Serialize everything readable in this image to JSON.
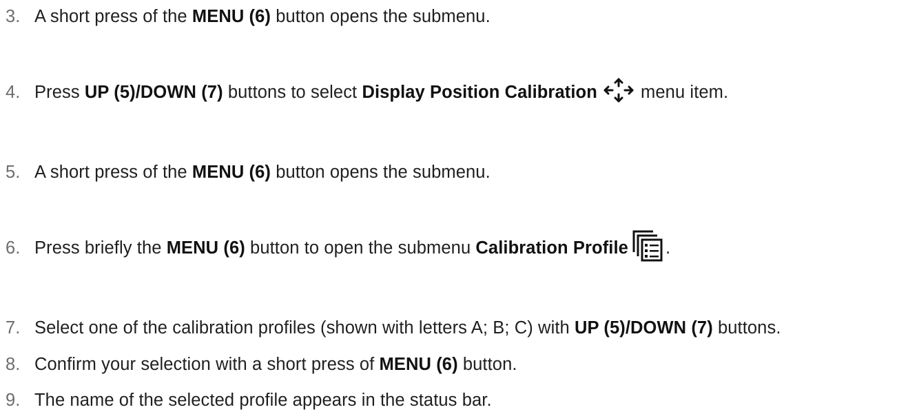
{
  "steps": [
    {
      "number": "3.",
      "parts": [
        "A short press of the ",
        "MENU (6)",
        " button opens the submenu."
      ]
    },
    {
      "number": "4.",
      "parts": [
        "Press ",
        "UP (5)/DOWN (7)",
        " buttons to select ",
        "Display Position Calibration",
        " menu item."
      ],
      "icon": "move-arrows-icon"
    },
    {
      "number": "5.",
      "parts": [
        "A short press of the ",
        "MENU (6)",
        " button opens the submenu."
      ]
    },
    {
      "number": "6.",
      "parts": [
        "Press briefly the ",
        "MENU (6)",
        " button to open the submenu ",
        "Calibration Profile",
        "."
      ],
      "icon": "calibration-profile-icon"
    },
    {
      "number": "7.",
      "parts": [
        "Select one of the calibration profiles (shown with letters A; B; C) with ",
        "UP (5)/DOWN (7)",
        " buttons."
      ]
    },
    {
      "number": "8.",
      "parts": [
        "Confirm your selection with a short press of ",
        "MENU (6)",
        " button."
      ]
    },
    {
      "number": "9.",
      "parts": [
        "The name of the selected profile appears in the status bar."
      ]
    }
  ]
}
